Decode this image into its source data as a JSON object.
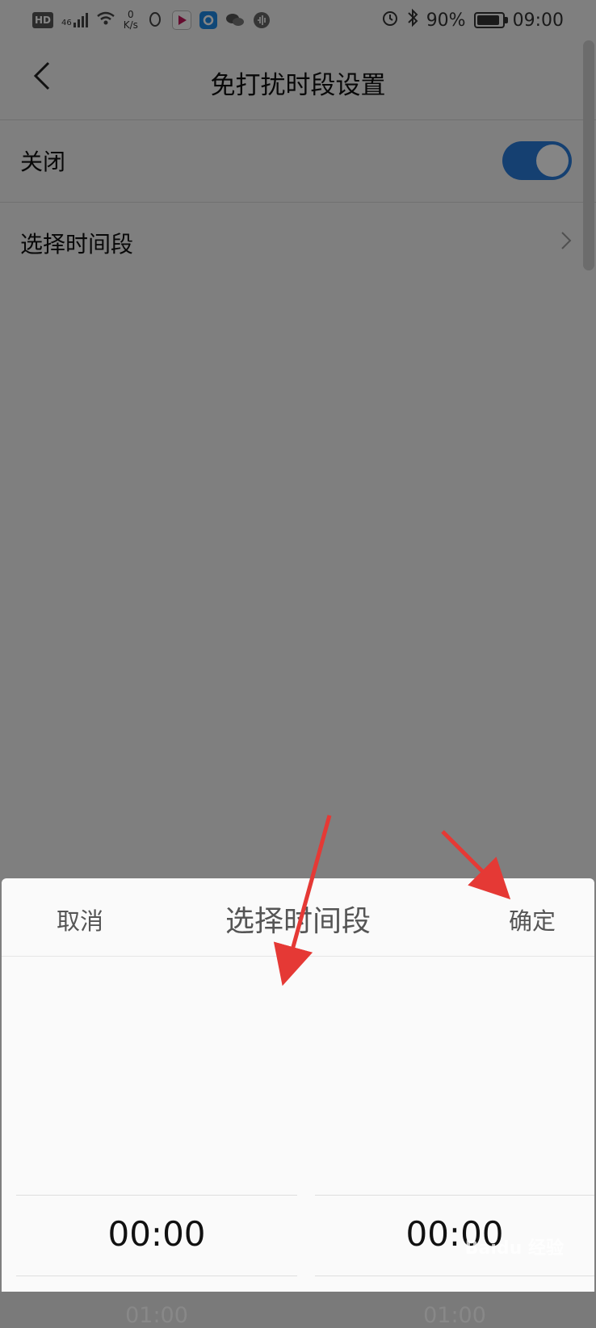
{
  "statusbar": {
    "left_hd": "HD",
    "left_net": "46",
    "left_speed_value": "0",
    "left_speed_unit": "K/s",
    "battery_percent_text": "90%",
    "battery_level": 0.9,
    "time": "09:00",
    "icons": [
      "hd-icon",
      "signal-icon",
      "wifi-icon",
      "qq-icon",
      "video-app-icon",
      "browser-app-icon",
      "wechat-icon",
      "audio-app-icon",
      "alarm-icon",
      "bluetooth-icon",
      "battery-icon"
    ]
  },
  "header": {
    "title": "免打扰时段设置",
    "back_icon": "chevron-left-icon"
  },
  "settings": {
    "toggle_row_label": "关闭",
    "toggle_on": true,
    "time_row_label": "选择时间段",
    "time_row_icon": "chevron-right-icon"
  },
  "sheet": {
    "title": "选择时间段",
    "cancel_label": "取消",
    "confirm_label": "确定",
    "start_picker": {
      "selected": "00:00",
      "next": "01:00"
    },
    "end_picker": {
      "selected": "00:00",
      "next": "01:00"
    }
  },
  "colors": {
    "toggle_on": "#2a7bd9",
    "annotation_arrow": "#e53935"
  },
  "watermark": "Baidu 经验"
}
